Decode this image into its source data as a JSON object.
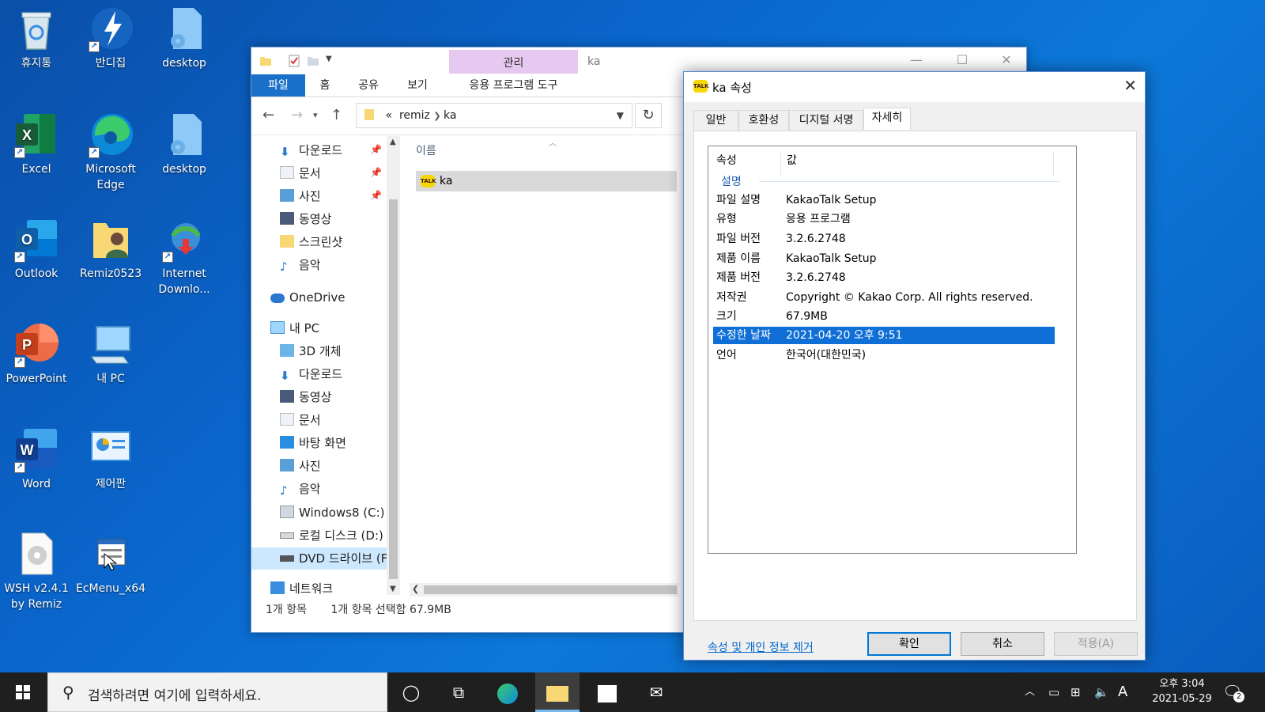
{
  "desktop": {
    "icons": [
      {
        "label": "휴지통"
      },
      {
        "label": "반디집"
      },
      {
        "label": "desktop"
      },
      {
        "label": "Excel"
      },
      {
        "label": "Microsoft Edge"
      },
      {
        "label": "desktop"
      },
      {
        "label": "Outlook"
      },
      {
        "label": "Remiz0523"
      },
      {
        "label": "Internet Downlo..."
      },
      {
        "label": "PowerPoint"
      },
      {
        "label": "내 PC"
      },
      {
        "label": "Word"
      },
      {
        "label": "제어판"
      },
      {
        "label": "WSH v2.4.1 by Remiz"
      },
      {
        "label": "EcMenu_x64"
      }
    ]
  },
  "explorer": {
    "title": "ka",
    "manage_tab": "관리",
    "app_tools_tab": "응용 프로그램 도구",
    "ribbon_tabs": [
      "파일",
      "홈",
      "공유",
      "보기"
    ],
    "breadcrumb": {
      "prefix": "«",
      "parent": "remiz",
      "current": "ka"
    },
    "nav_items": [
      {
        "label": "다운로드"
      },
      {
        "label": "문서"
      },
      {
        "label": "사진"
      },
      {
        "label": "동영상"
      },
      {
        "label": "스크린샷"
      },
      {
        "label": "음악"
      },
      {
        "label": "OneDrive"
      },
      {
        "label": "내 PC"
      },
      {
        "label": "3D 개체"
      },
      {
        "label": "다운로드"
      },
      {
        "label": "동영상"
      },
      {
        "label": "문서"
      },
      {
        "label": "바탕 화면"
      },
      {
        "label": "사진"
      },
      {
        "label": "음악"
      },
      {
        "label": "Windows8 (C:)"
      },
      {
        "label": "로컬 디스크 (D:)"
      },
      {
        "label": "DVD 드라이브 (F"
      },
      {
        "label": "네트워크"
      }
    ],
    "column_name": "이름",
    "files": [
      {
        "name": "ka"
      }
    ],
    "status": {
      "count": "1개 항목",
      "selected": "1개 항목 선택함 67.9MB"
    }
  },
  "properties": {
    "title": "ka 속성",
    "tabs": [
      "일반",
      "호환성",
      "디지털 서명",
      "자세히"
    ],
    "active_tab": "자세히",
    "col_property": "속성",
    "col_value": "값",
    "group": "설명",
    "rows": [
      {
        "k": "파일 설명",
        "v": "KakaoTalk Setup"
      },
      {
        "k": "유형",
        "v": "응용 프로그램"
      },
      {
        "k": "파일 버전",
        "v": "3.2.6.2748"
      },
      {
        "k": "제품 이름",
        "v": "KakaoTalk Setup"
      },
      {
        "k": "제품 버전",
        "v": "3.2.6.2748"
      },
      {
        "k": "저작권",
        "v": "Copyright © Kakao Corp. All rights reserved."
      },
      {
        "k": "크기",
        "v": "67.9MB"
      },
      {
        "k": "수정한 날짜",
        "v": "2021-04-20 오후 9:51"
      },
      {
        "k": "언어",
        "v": "한국어(대한민국)"
      }
    ],
    "selected_row": "수정한 날짜",
    "remove_link": "속성 및 개인 정보 제거",
    "buttons": {
      "ok": "확인",
      "cancel": "취소",
      "apply": "적용(A)"
    }
  },
  "taskbar": {
    "search_placeholder": "검색하려면 여기에 입력하세요.",
    "ime": "A",
    "time": "오후 3:04",
    "date": "2021-05-29",
    "notification_count": "2"
  },
  "colors": {
    "accent": "#0078d7",
    "desktop": "#0a66cc",
    "selection": "#0f6fd6",
    "manage_tab": "#e7c8f0"
  }
}
